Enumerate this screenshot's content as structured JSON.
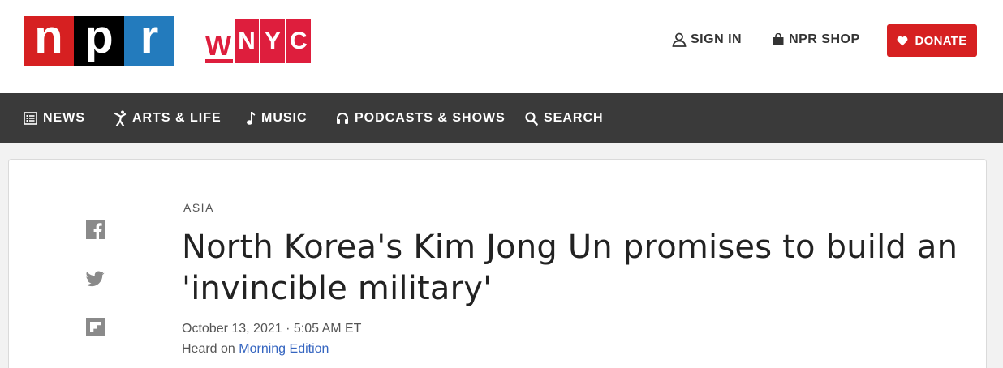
{
  "header": {
    "npr_logo_letters": [
      "n",
      "p",
      "r"
    ],
    "wnyc_logo_letters": [
      "W",
      "N",
      "Y",
      "C"
    ],
    "sign_in_label": "SIGN IN",
    "shop_label": "NPR SHOP",
    "donate_label": "DONATE"
  },
  "nav": {
    "items": [
      {
        "label": "NEWS",
        "icon": "news-list-icon"
      },
      {
        "label": "ARTS & LIFE",
        "icon": "dancer-icon"
      },
      {
        "label": "MUSIC",
        "icon": "music-note-icon"
      },
      {
        "label": "PODCASTS & SHOWS",
        "icon": "headphones-icon"
      },
      {
        "label": "SEARCH",
        "icon": "search-icon"
      }
    ]
  },
  "share": {
    "icons": [
      "facebook-icon",
      "twitter-icon",
      "flipboard-icon"
    ]
  },
  "article": {
    "section": "ASIA",
    "headline": "North Korea's Kim Jong Un promises to build an 'invincible military'",
    "dateline": "October 13, 2021 · 5:05 AM ET",
    "heard_prefix": "Heard on ",
    "heard_program": "Morning Edition"
  },
  "colors": {
    "npr_red": "#d62021",
    "npr_blue": "#237bbd",
    "wnyc_red": "#de1e3d",
    "nav_background": "#3a3a3a",
    "link_blue": "#3565c0"
  }
}
